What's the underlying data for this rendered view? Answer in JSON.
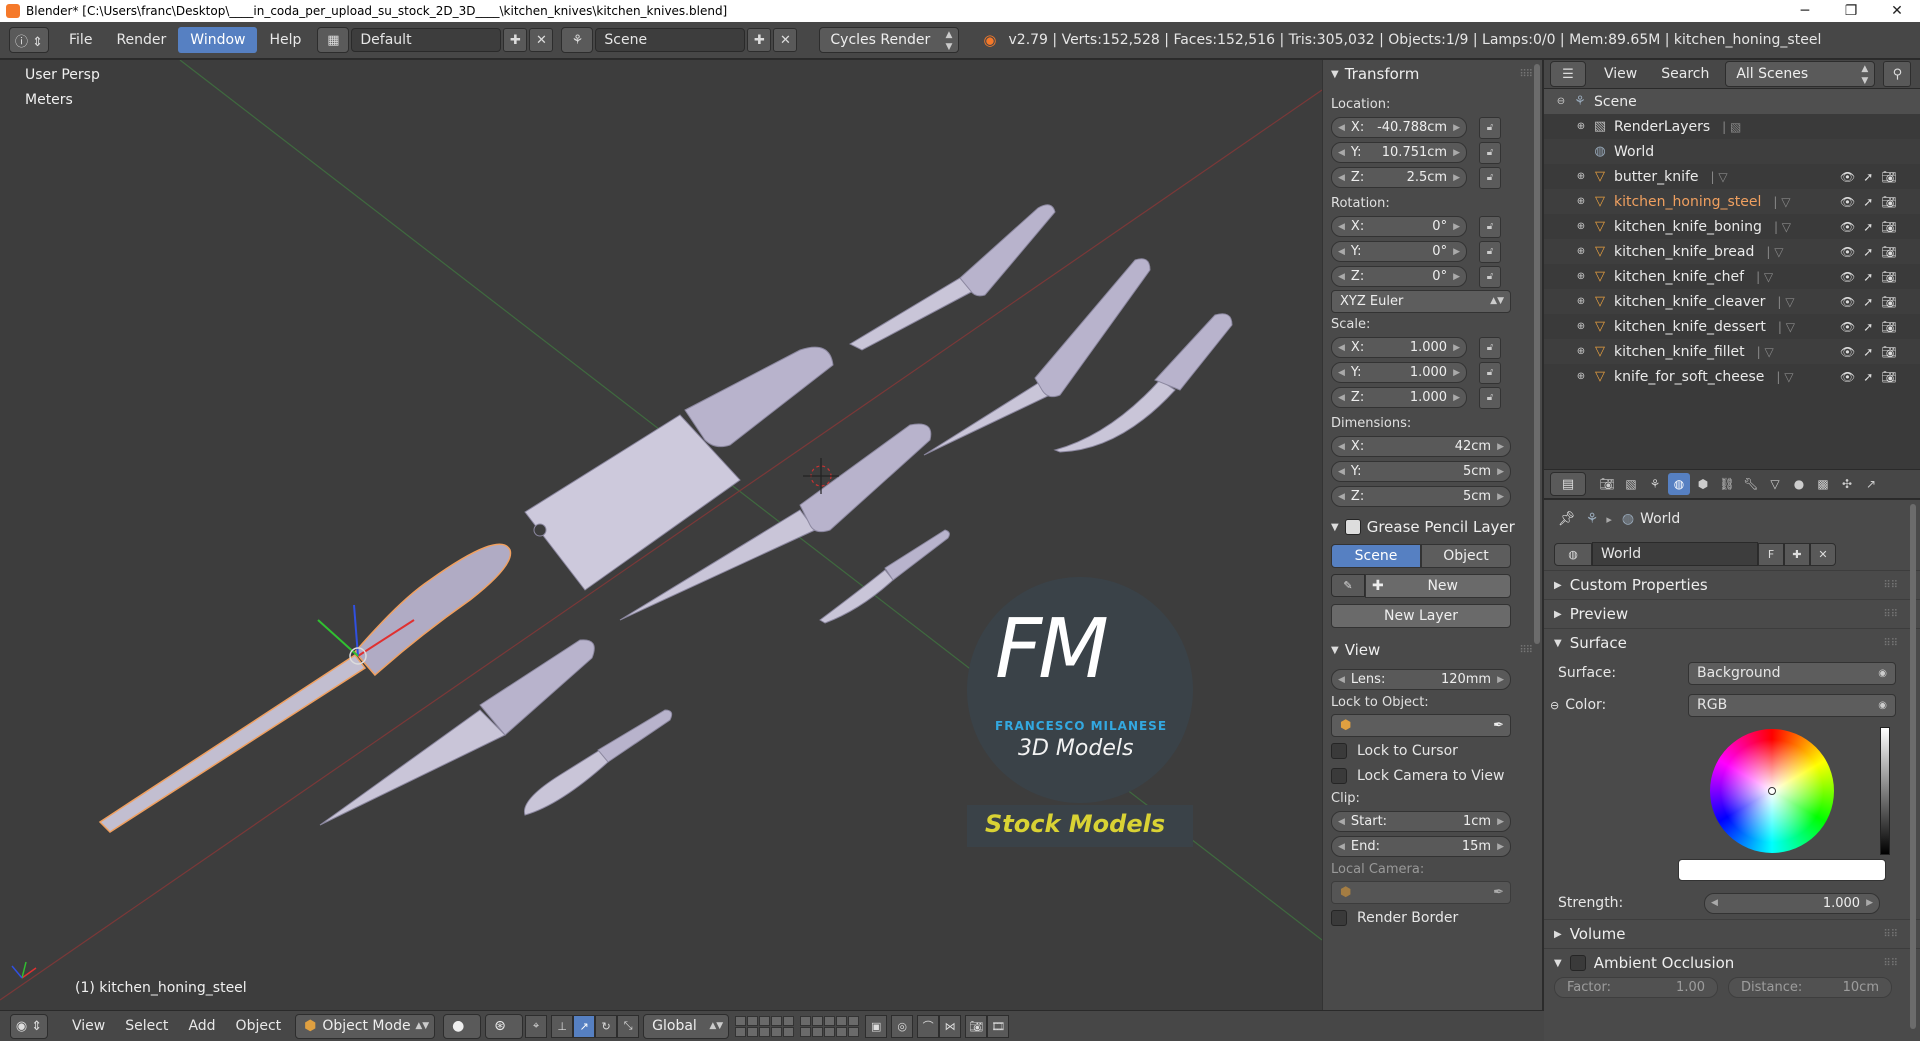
{
  "window": {
    "title": "Blender* [C:\\Users\\franc\\Desktop\\____in_coda_per_upload_su_stock_2D_3D____\\kitchen_knives\\kitchen_knives.blend]",
    "minimize": "─",
    "maximize": "❐",
    "close": "✕"
  },
  "info_header": {
    "menus": [
      "File",
      "Render",
      "Window",
      "Help"
    ],
    "active_menu": "Window",
    "screen_layout": "Default",
    "scene": "Scene",
    "render_engine": "Cycles Render",
    "stats": "v2.79 | Verts:152,528 | Faces:152,516 | Tris:305,032 | Objects:1/9 | Lamps:0/0 | Mem:89.65M | kitchen_honing_steel"
  },
  "viewport": {
    "view_name": "User Persp",
    "units": "Meters",
    "active_object_label": "(1) kitchen_honing_steel",
    "watermark": {
      "logo": "FM",
      "name": "FRANCESCO MILANESE",
      "sub": "3D Models",
      "banner": "Stock Models"
    }
  },
  "npanel": {
    "transform": {
      "title": "Transform",
      "location_label": "Location:",
      "location": [
        {
          "axis": "X:",
          "value": "-40.788cm"
        },
        {
          "axis": "Y:",
          "value": "10.751cm"
        },
        {
          "axis": "Z:",
          "value": "2.5cm"
        }
      ],
      "rotation_label": "Rotation:",
      "rotation": [
        {
          "axis": "X:",
          "value": "0°"
        },
        {
          "axis": "Y:",
          "value": "0°"
        },
        {
          "axis": "Z:",
          "value": "0°"
        }
      ],
      "rotation_mode": "XYZ Euler",
      "scale_label": "Scale:",
      "scale": [
        {
          "axis": "X:",
          "value": "1.000"
        },
        {
          "axis": "Y:",
          "value": "1.000"
        },
        {
          "axis": "Z:",
          "value": "1.000"
        }
      ],
      "dimensions_label": "Dimensions:",
      "dimensions": [
        {
          "axis": "X:",
          "value": "42cm"
        },
        {
          "axis": "Y:",
          "value": "5cm"
        },
        {
          "axis": "Z:",
          "value": "5cm"
        }
      ]
    },
    "grease_pencil": {
      "title": "Grease Pencil Layer",
      "scene_tab": "Scene",
      "object_tab": "Object",
      "new_button": "New",
      "new_layer_button": "New Layer"
    },
    "view": {
      "title": "View",
      "lens_label": "Lens:",
      "lens": "120mm",
      "lock_to_object_label": "Lock to Object:",
      "lock_to_cursor": "Lock to Cursor",
      "lock_camera_to_view": "Lock Camera to View",
      "clip_label": "Clip:",
      "clip_start_label": "Start:",
      "clip_start": "1cm",
      "clip_end_label": "End:",
      "clip_end": "15m",
      "local_camera_label": "Local Camera:",
      "render_border": "Render Border"
    }
  },
  "outliner": {
    "menus": [
      "View",
      "Search"
    ],
    "display_mode": "All Scenes",
    "scene": "Scene",
    "items": [
      {
        "name": "RenderLayers",
        "kind": "renderlayers"
      },
      {
        "name": "World",
        "kind": "world"
      },
      {
        "name": "butter_knife",
        "kind": "mesh"
      },
      {
        "name": "kitchen_honing_steel",
        "kind": "mesh",
        "selected": true
      },
      {
        "name": "kitchen_knife_boning",
        "kind": "mesh"
      },
      {
        "name": "kitchen_knife_bread",
        "kind": "mesh"
      },
      {
        "name": "kitchen_knife_chef",
        "kind": "mesh"
      },
      {
        "name": "kitchen_knife_cleaver",
        "kind": "mesh"
      },
      {
        "name": "kitchen_knife_dessert",
        "kind": "mesh"
      },
      {
        "name": "kitchen_knife_fillet",
        "kind": "mesh"
      },
      {
        "name": "knife_for_soft_cheese",
        "kind": "mesh"
      }
    ]
  },
  "properties": {
    "breadcrumb": "World",
    "world_name": "World",
    "fake_user": "F",
    "sections": {
      "custom_properties": "Custom Properties",
      "preview": "Preview",
      "surface": "Surface",
      "volume": "Volume",
      "ambient_occlusion": "Ambient Occlusion"
    },
    "surface_label": "Surface:",
    "surface_value": "Background",
    "color_label": "Color:",
    "color_value": "RGB",
    "strength_label": "Strength:",
    "strength_value": "1.000",
    "factor_label": "Factor:",
    "factor_value": "1.00",
    "distance_label": "Distance:",
    "distance_value": "10cm"
  },
  "bottom_header": {
    "menus": [
      "View",
      "Select",
      "Add",
      "Object"
    ],
    "mode": "Object Mode",
    "orientation": "Global"
  },
  "colors": {
    "accent": "#5680c2",
    "selected_orange": "#f0a060",
    "watermark_blue": "#33a8e0",
    "banner_yellow": "#d9d234"
  }
}
